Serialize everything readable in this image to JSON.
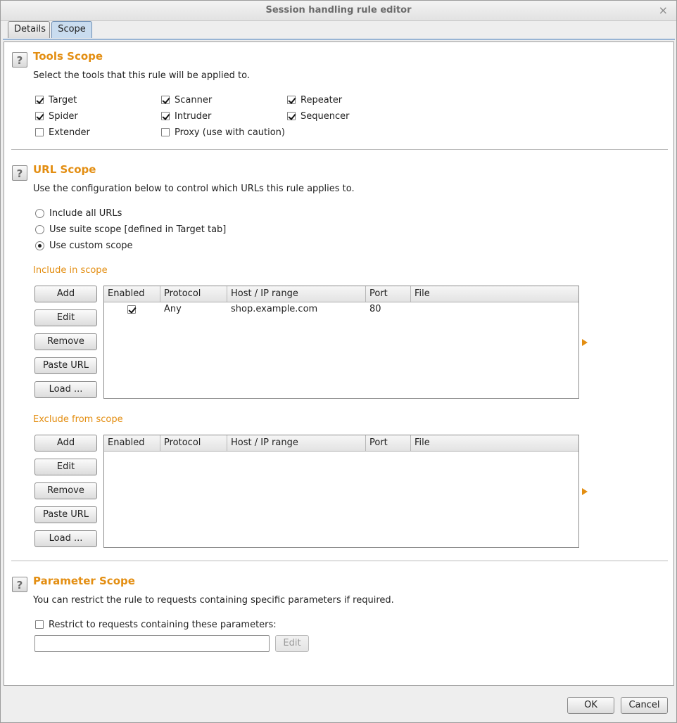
{
  "window": {
    "title": "Session handling rule editor",
    "close_glyph": "×"
  },
  "tabs": [
    {
      "label": "Details"
    },
    {
      "label": "Scope"
    }
  ],
  "tools_scope": {
    "heading": "Tools Scope",
    "description": "Select the tools that this rule will be applied to.",
    "tools": [
      {
        "label": "Target",
        "checked": true
      },
      {
        "label": "Scanner",
        "checked": true
      },
      {
        "label": "Repeater",
        "checked": true
      },
      {
        "label": "Spider",
        "checked": true
      },
      {
        "label": "Intruder",
        "checked": true
      },
      {
        "label": "Sequencer",
        "checked": true
      },
      {
        "label": "Extender",
        "checked": false
      },
      {
        "label": "Proxy (use with caution)",
        "checked": false
      }
    ]
  },
  "url_scope": {
    "heading": "URL Scope",
    "description": "Use the configuration below to control which URLs this rule applies to.",
    "options": [
      {
        "label": "Include all URLs",
        "selected": false
      },
      {
        "label": "Use suite scope [defined in Target tab]",
        "selected": false
      },
      {
        "label": "Use custom scope",
        "selected": true
      }
    ],
    "include": {
      "title": "Include in scope",
      "buttons": [
        "Add",
        "Edit",
        "Remove",
        "Paste URL",
        "Load ..."
      ],
      "columns": [
        "Enabled",
        "Protocol",
        "Host / IP range",
        "Port",
        "File"
      ],
      "rows": [
        {
          "enabled": true,
          "protocol": "Any",
          "host": "shop.example.com",
          "port": "80",
          "file": ""
        }
      ]
    },
    "exclude": {
      "title": "Exclude from scope",
      "buttons": [
        "Add",
        "Edit",
        "Remove",
        "Paste URL",
        "Load ..."
      ],
      "columns": [
        "Enabled",
        "Protocol",
        "Host / IP range",
        "Port",
        "File"
      ],
      "rows": []
    }
  },
  "parameter_scope": {
    "heading": "Parameter Scope",
    "description": "You can restrict the rule to requests containing specific parameters if required.",
    "restrict_label": "Restrict to requests containing these parameters:",
    "restrict_checked": false,
    "input_value": "",
    "edit_label": "Edit"
  },
  "footer": {
    "ok_label": "OK",
    "cancel_label": "Cancel"
  },
  "colors": {
    "accent": "#e38e12",
    "tab_selected": "#c9dcef"
  },
  "help_glyph": "?"
}
